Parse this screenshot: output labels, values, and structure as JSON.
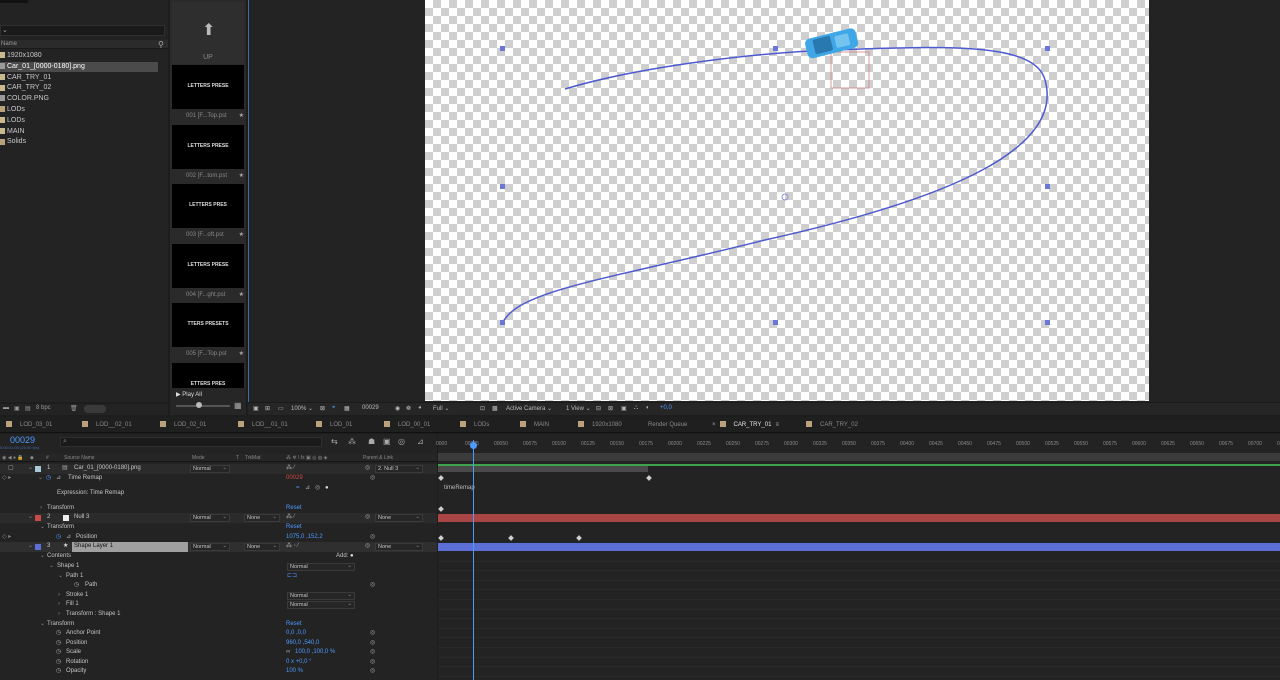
{
  "project": {
    "header_label": "Name",
    "items": [
      {
        "label": "1920x1080",
        "color": "#c9b98f",
        "selected": false
      },
      {
        "label": "Car_01_[0000-0180].png",
        "color": "#9a9a9a",
        "selected": true
      },
      {
        "label": "CAR_TRY_01",
        "color": "#c9b98f",
        "selected": false
      },
      {
        "label": "CAR_TRY_02",
        "color": "#c9b98f",
        "selected": false
      },
      {
        "label": "COLOR.PNG",
        "color": "#9a9a9a",
        "selected": false
      },
      {
        "label": "LODs",
        "color": "#b8a37a",
        "selected": false
      },
      {
        "label": "LODs",
        "color": "#c9b98f",
        "selected": false
      },
      {
        "label": "MAIN",
        "color": "#c9b98f",
        "selected": false
      },
      {
        "label": "Solids",
        "color": "#b8a37a",
        "selected": false
      }
    ],
    "footer_bpc": "8 bpc"
  },
  "presets": {
    "up_label": "UP",
    "thumbs": [
      {
        "text": "LETTERS PRESE",
        "label": "001 [F...Top.pst"
      },
      {
        "text": "LETTERS PRESE",
        "label": "002 [F...tom.pst"
      },
      {
        "text": "LETTERS PRES",
        "label": "003 [F...oft.pst"
      },
      {
        "text": "LETTERS PRESE",
        "label": "004 [F...ght.pst"
      },
      {
        "text": "TTERS PRESETS",
        "label": "005 [F...Top.pst"
      },
      {
        "text": "ETTERS PRES",
        "label": ""
      }
    ],
    "play_all": "Play All"
  },
  "viewer_toolbar": {
    "zoom": "100%",
    "timecode": "00029",
    "resolution": "Full",
    "camera": "Active Camera",
    "views": "1 View",
    "exposure": "+0,0"
  },
  "tabs": [
    {
      "label": "LOD_03_01",
      "active": false
    },
    {
      "label": "LOD__02_01",
      "active": false
    },
    {
      "label": "LOD_02_01",
      "active": false
    },
    {
      "label": "LOD__01_01",
      "active": false
    },
    {
      "label": "LOD_01",
      "active": false
    },
    {
      "label": "LOD_00_01",
      "active": false
    },
    {
      "label": "LODs",
      "active": false
    },
    {
      "label": "MAIN",
      "active": false
    },
    {
      "label": "1920x1080",
      "active": false
    },
    {
      "label": "Render Queue",
      "active": false
    },
    {
      "label": "CAR_TRY_01",
      "active": true
    },
    {
      "label": "CAR_TRY_02",
      "active": false
    }
  ],
  "timeline": {
    "timecode": "00029",
    "timecode_sub": "0:00:01:05 (25.00 fps)",
    "columns": {
      "num": "#",
      "source": "Source Name",
      "mode": "Mode",
      "t": "T",
      "trkmat": "TrkMat",
      "parent": "Parent & Link"
    },
    "ruler": [
      "0000",
      "00025",
      "00050",
      "00075",
      "00100",
      "00125",
      "00150",
      "00175",
      "00200",
      "00225",
      "00250",
      "00275",
      "00300",
      "00325",
      "00350",
      "00375",
      "00400",
      "00425",
      "00450",
      "00475",
      "00500",
      "00525",
      "00550",
      "00575",
      "00600",
      "00625",
      "00650",
      "00675",
      "00700",
      "0072"
    ],
    "layer1": {
      "num": "1",
      "name": "Car_01_[0000-0180].png",
      "mode": "Normal",
      "parent": "2. Null 3",
      "color": "#a6c9d6"
    },
    "time_remap": {
      "label": "Time Remap",
      "value": "00029"
    },
    "expression_label": "Expression: Time Remap",
    "expression_text": "timeRemap",
    "transform1": {
      "label": "Transform",
      "reset": "Reset"
    },
    "layer2": {
      "num": "2",
      "name": "Null 3",
      "mode": "Normal",
      "trkmat": "None",
      "parent": "None",
      "color": "#c84a4a"
    },
    "transform2": {
      "label": "Transform",
      "reset": "Reset"
    },
    "position2": {
      "label": "Position",
      "value": "1075,0 ,152,2"
    },
    "layer3": {
      "num": "3",
      "name": "Shape Layer 1",
      "mode": "Normal",
      "trkmat": "None",
      "parent": "None",
      "color": "#5b6fd6"
    },
    "contents": {
      "label": "Contents",
      "add": "Add:"
    },
    "shape1": {
      "label": "Shape 1",
      "mode": "Normal"
    },
    "path1": "Path 1",
    "path": "Path",
    "stroke1": {
      "label": "Stroke 1",
      "mode": "Normal"
    },
    "fill1": {
      "label": "Fill 1",
      "mode": "Normal"
    },
    "transform_shape": "Transform : Shape 1",
    "transform3": {
      "label": "Transform",
      "reset": "Reset"
    },
    "anchor": {
      "label": "Anchor Point",
      "value": "0,0 ,0,0"
    },
    "position3": {
      "label": "Position",
      "value": "960,0 ,540,0"
    },
    "scale": {
      "label": "Scale",
      "value": "100,0 ,100,0 %"
    },
    "rotation": {
      "label": "Rotation",
      "value": "0 x +0,0 °"
    },
    "opacity": {
      "label": "Opacity",
      "value": "100 %"
    }
  },
  "colors": {
    "accent": "#4d9aff",
    "null_bar": "#a94545",
    "shape_bar": "#5b6fd6",
    "layer1_bar": "#4a4a4a",
    "path_stroke": "#4e5bd0",
    "car": "#3fa7e6"
  }
}
